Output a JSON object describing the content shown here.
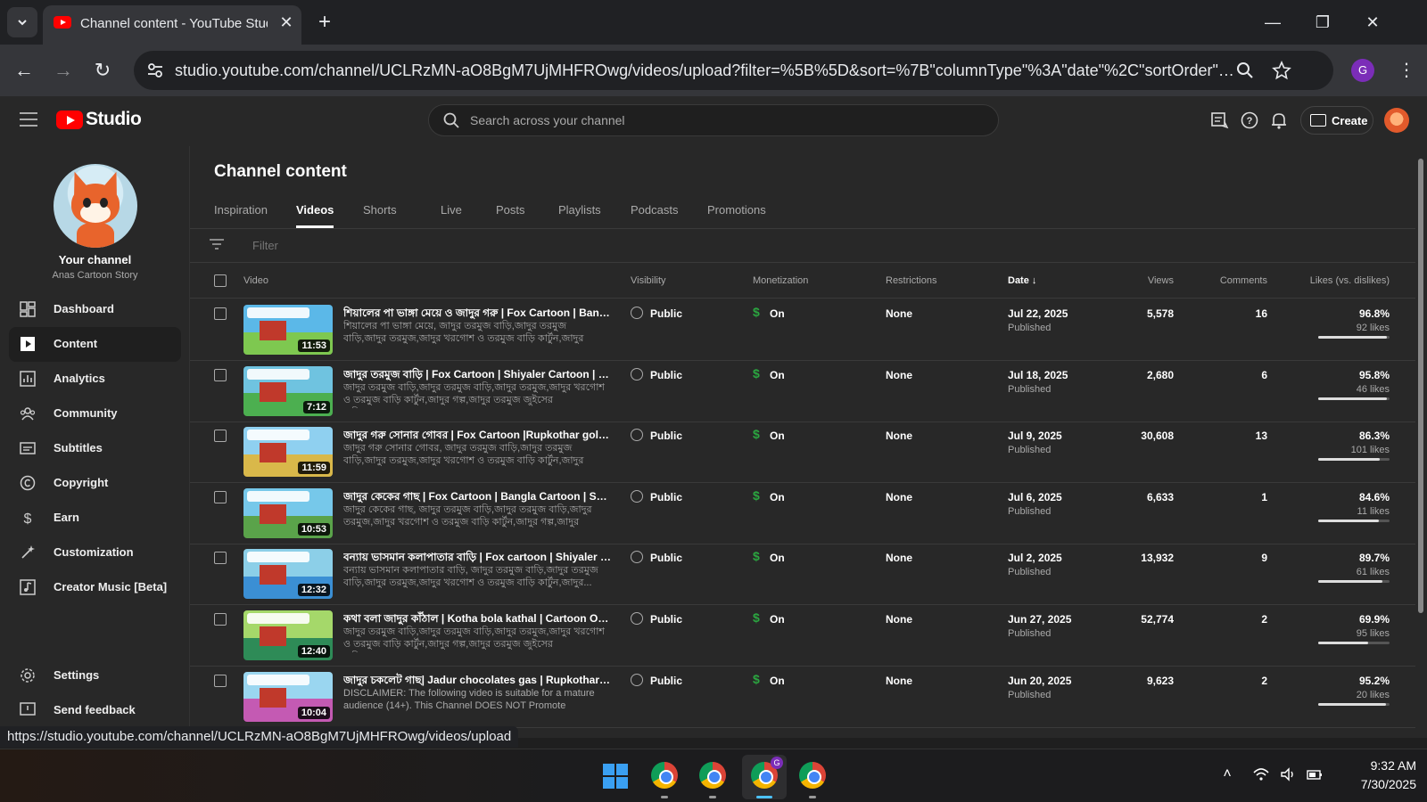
{
  "browser": {
    "tab_title": "Channel content - YouTube Studio",
    "url": "studio.youtube.com/channel/UCLRzMN-aO8BgM7UjMHFROwg/videos/upload?filter=%5B%5D&sort=%7B\"columnType\"%3A\"date\"%2C\"sortOrder\"%3A\"D...",
    "profile_initial": "G",
    "status_url": "https://studio.youtube.com/channel/UCLRzMN-aO8BgM7UjMHFROwg/videos/upload"
  },
  "header": {
    "logo_text": "Studio",
    "search_placeholder": "Search across your channel",
    "create_label": "Create"
  },
  "sidebar": {
    "your_channel": "Your channel",
    "channel_name": "Anas Cartoon Story",
    "items": [
      {
        "label": "Dashboard",
        "icon": "dashboard-icon"
      },
      {
        "label": "Content",
        "icon": "content-icon"
      },
      {
        "label": "Analytics",
        "icon": "analytics-icon"
      },
      {
        "label": "Community",
        "icon": "community-icon"
      },
      {
        "label": "Subtitles",
        "icon": "subtitles-icon"
      },
      {
        "label": "Copyright",
        "icon": "copyright-icon"
      },
      {
        "label": "Earn",
        "icon": "earn-icon"
      },
      {
        "label": "Customization",
        "icon": "customization-icon"
      },
      {
        "label": "Creator Music [Beta]",
        "icon": "creator-music-icon"
      }
    ],
    "settings": "Settings",
    "feedback": "Send feedback"
  },
  "main": {
    "title": "Channel content",
    "tabs": [
      "Inspiration",
      "Videos",
      "Shorts",
      "Live",
      "Posts",
      "Playlists",
      "Podcasts",
      "Promotions"
    ],
    "active_tab": "Videos",
    "filter_placeholder": "Filter",
    "columns": {
      "video": "Video",
      "visibility": "Visibility",
      "monetization": "Monetization",
      "restrictions": "Restrictions",
      "date": "Date",
      "views": "Views",
      "comments": "Comments",
      "likes": "Likes (vs. dislikes)"
    },
    "rows": [
      {
        "title": "শিয়ালের পা ভাঙ্গা মেয়ে ও জাদুর গরু | Fox Cartoon | Bangla Car...",
        "desc": "শিয়ালের পা ভাঙ্গা মেয়ে, জাদুর তরমুজ বাড়ি,জাদুর তরমুজ বাড়ি,জাদুর তরমুজ,জাদুর খরগোশ ও তরমুজ বাড়ি কার্টুন,জাদুর গল্প,জাদুর তরমুজ...",
        "duration": "11:53",
        "visibility": "Public",
        "monetization": "On",
        "restrictions": "None",
        "date": "Jul 22, 2025",
        "status": "Published",
        "views": "5,578",
        "comments": "16",
        "likes_pct": "96.8%",
        "likes": "92 likes",
        "likes_ratio": 0.968
      },
      {
        "title": "জাদুর তরমুজ বাড়ি | Fox Cartoon | Shiyaler Cartoon | Bangla C...",
        "desc": "জাদুর তরমুজ বাড়ি,জাদুর তরমুজ বাড়ি,জাদুর তরমুজ,জাদুর খরগোশ ও তরমুজ বাড়ি কার্টুন,জাদুর গল্প,জাদুর তরমুজ জুইসের বাড়ি,তরমুজ...",
        "duration": "7:12",
        "visibility": "Public",
        "monetization": "On",
        "restrictions": "None",
        "date": "Jul 18, 2025",
        "status": "Published",
        "views": "2,680",
        "comments": "6",
        "likes_pct": "95.8%",
        "likes": "46 likes",
        "likes_ratio": 0.958
      },
      {
        "title": "জাদুর গরু সোনার গোবর | Fox Cartoon |Rupkothar golpo | Ban...",
        "desc": "জাদুর গরু সোনার গোবর, জাদুর তরমুজ বাড়ি,জাদুর তরমুজ বাড়ি,জাদুর তরমুজ,জাদুর খরগোশ ও তরমুজ বাড়ি কার্টুন,জাদুর গল্প,জাদুর তরমুজ...",
        "duration": "11:59",
        "visibility": "Public",
        "monetization": "On",
        "restrictions": "None",
        "date": "Jul 9, 2025",
        "status": "Published",
        "views": "30,608",
        "comments": "13",
        "likes_pct": "86.3%",
        "likes": "101 likes",
        "likes_ratio": 0.863
      },
      {
        "title": "জাদুর কেকের গাছ | Fox Cartoon | Bangla Cartoon | Shiyaler C...",
        "desc": "জাদুর কেকের গাছ, জাদুর তরমুজ বাড়ি,জাদুর তরমুজ বাড়ি,জাদুর তরমুজ,জাদুর খরগোশ ও তরমুজ বাড়ি কার্টুন,জাদুর গল্প,জাদুর তরমুজ...",
        "duration": "10:53",
        "visibility": "Public",
        "monetization": "On",
        "restrictions": "None",
        "date": "Jul 6, 2025",
        "status": "Published",
        "views": "6,633",
        "comments": "1",
        "likes_pct": "84.6%",
        "likes": "11 likes",
        "likes_ratio": 0.846
      },
      {
        "title": "বন্যায় ভাসমান কলাপাতার বাড়ি | Fox cartoon | Shiyaler Cartoo...",
        "desc": "বন্যায় ভাসমান কলাপাতার বাড়ি, জাদুর তরমুজ বাড়ি,জাদুর তরমুজ বাড়ি,জাদুর তরমুজ,জাদুর খরগোশ ও তরমুজ বাড়ি কার্টুন,জাদুর...",
        "duration": "12:32",
        "visibility": "Public",
        "monetization": "On",
        "restrictions": "None",
        "date": "Jul 2, 2025",
        "status": "Published",
        "views": "13,932",
        "comments": "9",
        "likes_pct": "89.7%",
        "likes": "61 likes",
        "likes_ratio": 0.897
      },
      {
        "title": "কথা বলা জাদুর কাঁঠাল | Kotha bola kathal | Cartoon On | Rupk...",
        "desc": "জাদুর তরমুজ বাড়ি,জাদুর তরমুজ বাড়ি,জাদুর তরমুজ,জাদুর খরগোশ ও তরমুজ বাড়ি কার্টুন,জাদুর গল্প,জাদুর তরমুজ জুইসের বাড়ি,তরমুজ...",
        "duration": "12:40",
        "visibility": "Public",
        "monetization": "On",
        "restrictions": "None",
        "date": "Jun 27, 2025",
        "status": "Published",
        "views": "52,774",
        "comments": "2",
        "likes_pct": "69.9%",
        "likes": "95 likes",
        "likes_ratio": 0.699
      },
      {
        "title": "জাদুর চকলেট গাছ| Jadur chocolates gas | Rupkothar golpo | ...",
        "desc": "DISCLAIMER: The following video is suitable for a mature audience (14+). This Channel DOES NOT Promote Encourage An...",
        "duration": "10:04",
        "visibility": "Public",
        "monetization": "On",
        "restrictions": "None",
        "date": "Jun 20, 2025",
        "status": "Published",
        "views": "9,623",
        "comments": "2",
        "likes_pct": "95.2%",
        "likes": "20 likes",
        "likes_ratio": 0.952
      }
    ]
  },
  "taskbar": {
    "time": "9:32 AM",
    "date": "7/30/2025",
    "badge": "G"
  },
  "colors": {
    "brand": "#ff0000",
    "monetization": "#2ba640",
    "background": "#282828"
  }
}
